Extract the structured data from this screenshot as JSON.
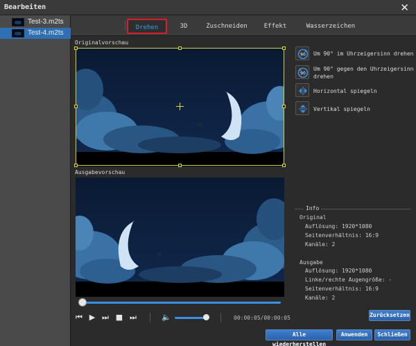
{
  "window": {
    "title": "Bearbeiten"
  },
  "files": [
    {
      "name": "Test-3.m2ts",
      "selected": false
    },
    {
      "name": "Test-4.m2ts",
      "selected": true
    }
  ],
  "tabs": [
    {
      "label": "Drehen",
      "active": true
    },
    {
      "label": "3D"
    },
    {
      "label": "Zuschneiden"
    },
    {
      "label": "Effekt"
    },
    {
      "label": "Wasserzeichen"
    }
  ],
  "preview": {
    "original_label": "Originalvorschau",
    "output_label": "Ausgabevorschau"
  },
  "playback": {
    "time": "00:00:05/00:00:05",
    "progress": 0.0,
    "volume": 0.85
  },
  "rotate": {
    "cw_label": "Um 90° im Uhrzeigersinn drehen",
    "ccw_label_1": "Um 90° gegen den Uhrzeigersinn",
    "ccw_label_2": "drehen",
    "flip_h_label": "Horizontal spiegeln",
    "flip_v_label": "Vertikal spiegeln"
  },
  "info": {
    "title": "Info",
    "original": {
      "heading": "Original",
      "resolution": "Auflösung: 1920*1080",
      "aspect": "Seitenverhältnis: 16:9",
      "channels": "Kanäle: 2"
    },
    "output": {
      "heading": "Ausgabe",
      "resolution": "Auflösung: 1920*1080",
      "eye_size": "Linke/rechte Augengröße: -",
      "aspect": "Seitenverhältnis: 16:9",
      "channels": "Kanäle: 2"
    }
  },
  "buttons": {
    "reset": "Zurücksetzen",
    "restore_all": "Alle wiederherstellen",
    "apply": "Anwenden",
    "close": "Schließen"
  },
  "colors": {
    "accent": "#3d8fe6",
    "selection": "#2f6fb3",
    "active_tab_border": "#d6202a",
    "crop_frame": "#d6d23a"
  }
}
